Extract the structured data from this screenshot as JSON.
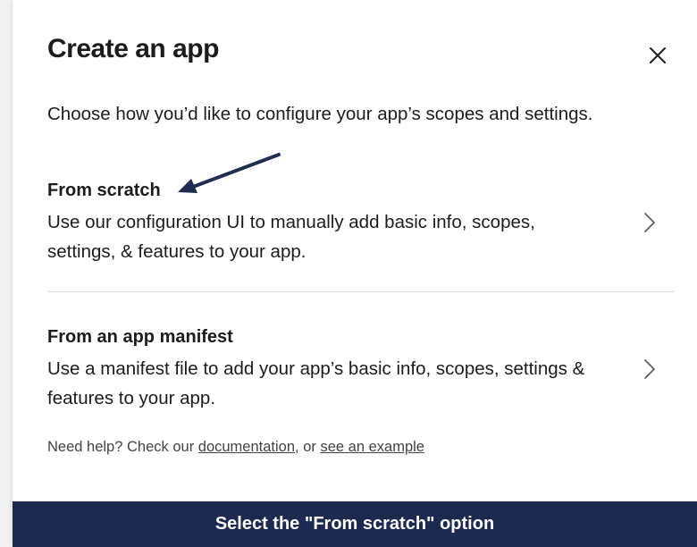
{
  "modal": {
    "title": "Create an app",
    "intro": "Choose how you’d like to configure your app’s scopes and settings."
  },
  "options": [
    {
      "title": "From scratch",
      "description": "Use our configuration UI to manually add basic info, scopes, settings, & features to your app."
    },
    {
      "title": "From an app manifest",
      "description": "Use a manifest file to add your app’s basic info, scopes, settings & features to your app."
    }
  ],
  "help": {
    "prefix": "Need help? Check our ",
    "link1": "documentation",
    "middle": ", or ",
    "link2": "see an example"
  },
  "banner": {
    "text": "Select the \"From scratch\" option"
  },
  "icons": {
    "close": "close-icon",
    "chevron": "chevron-right-icon",
    "annotation": "arrow-annotation"
  },
  "colors": {
    "banner_bg": "#1b2a4e",
    "text": "#1d1c1d",
    "arrow": "#1f2d52"
  }
}
